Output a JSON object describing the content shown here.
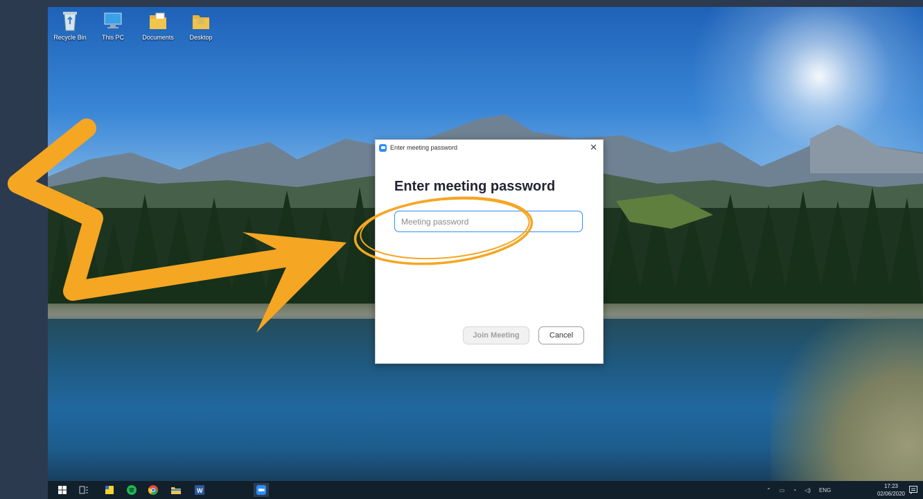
{
  "desktop": {
    "icons": [
      {
        "label": "Recycle Bin",
        "icon": "recycle-bin-icon"
      },
      {
        "label": "This PC",
        "icon": "computer-icon"
      },
      {
        "label": "Documents",
        "icon": "folder-documents-icon"
      },
      {
        "label": "Desktop",
        "icon": "folder-desktop-icon"
      }
    ]
  },
  "dialog": {
    "window_title": "Enter meeting password",
    "heading": "Enter meeting password",
    "password_placeholder": "Meeting password",
    "password_value": "",
    "join_label": "Join Meeting",
    "cancel_label": "Cancel",
    "close_glyph": "✕"
  },
  "taskbar": {
    "apps": [
      "windows-start-icon",
      "task-view-icon",
      "sticky-notes-icon",
      "spotify-icon",
      "chrome-icon",
      "file-explorer-icon",
      "word-icon",
      "zoom-icon"
    ],
    "tray_lang": "ENG",
    "time": "17:23",
    "date": "02/06/2020"
  },
  "colors": {
    "accent": "#2d8cff",
    "annotation": "#f5a623",
    "taskbar": "#12202c",
    "frame": "#2c3a4f"
  }
}
